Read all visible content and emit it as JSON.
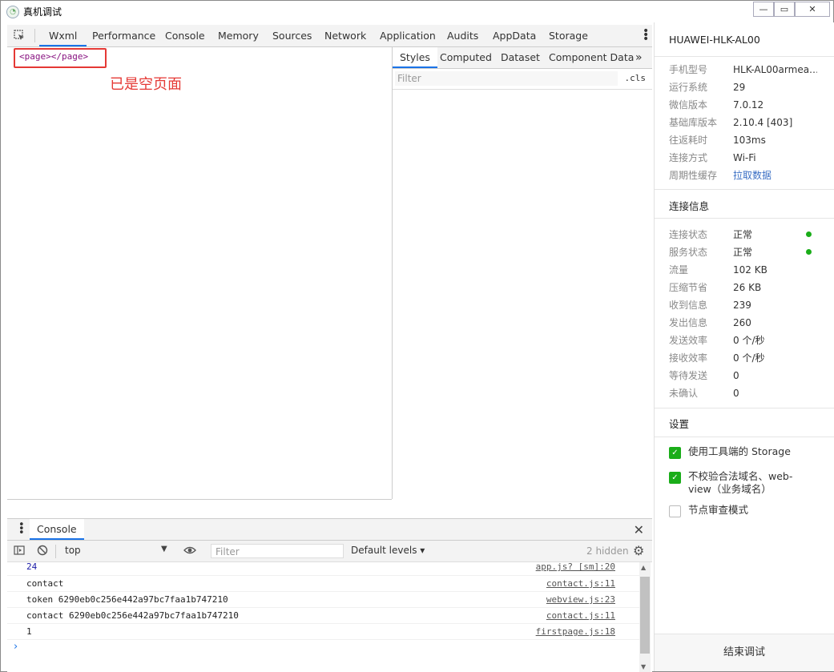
{
  "window": {
    "title": "真机调试",
    "min": "—",
    "restore": "▭",
    "close": "✕"
  },
  "devtools": {
    "tabs": [
      "Wxml",
      "Performance",
      "Console",
      "Memory",
      "Sources",
      "Network",
      "Application",
      "Audits",
      "AppData",
      "Storage"
    ],
    "active_tab": "Wxml"
  },
  "elements": {
    "node": "<page></page>",
    "annotation": "已是空页面"
  },
  "styles": {
    "tabs": [
      "Styles",
      "Computed",
      "Dataset",
      "Component Data"
    ],
    "more": "»",
    "filter_placeholder": "Filter",
    "cls": ".cls"
  },
  "console": {
    "tab": "Console",
    "context": "top",
    "filter_placeholder": "Filter",
    "levels": "Default levels ▾",
    "hidden": "2 hidden",
    "logs": [
      {
        "msg": "24",
        "src": "app.js? [sm]:20",
        "num": true
      },
      {
        "msg": "contact",
        "src": "contact.js:11",
        "num": false
      },
      {
        "msg": "token 6290eb0c256e442a97bc7faa1b747210",
        "src": "webview.js:23",
        "num": false
      },
      {
        "msg": "contact 6290eb0c256e442a97bc7faa1b747210",
        "src": "contact.js:11",
        "num": false
      },
      {
        "msg": "1",
        "src": "firstpage.js:18",
        "num": false
      }
    ],
    "prompt": "›"
  },
  "side": {
    "device": "HUAWEI-HLK-AL00",
    "device_info": [
      {
        "k": "手机型号",
        "v": "HLK-AL00armea…"
      },
      {
        "k": "运行系统",
        "v": "29"
      },
      {
        "k": "微信版本",
        "v": "7.0.12"
      },
      {
        "k": "基础库版本",
        "v": "2.10.4 [403]"
      },
      {
        "k": "往返耗时",
        "v": "103ms"
      },
      {
        "k": "连接方式",
        "v": "Wi-Fi"
      },
      {
        "k": "周期性缓存",
        "v": "拉取数据"
      }
    ],
    "conn_title": "连接信息",
    "conn_info": [
      {
        "k": "连接状态",
        "v": "正常"
      },
      {
        "k": "服务状态",
        "v": "正常"
      },
      {
        "k": "流量",
        "v": "102 KB"
      },
      {
        "k": "压缩节省",
        "v": "26 KB"
      },
      {
        "k": "收到信息",
        "v": "239"
      },
      {
        "k": "发出信息",
        "v": "260"
      },
      {
        "k": "发送效率",
        "v": "0 个/秒"
      },
      {
        "k": "接收效率",
        "v": "0 个/秒"
      },
      {
        "k": "等待发送",
        "v": "0"
      },
      {
        "k": "未确认",
        "v": "0"
      }
    ],
    "settings_title": "设置",
    "settings": [
      {
        "label": "使用工具端的 Storage",
        "checked": true
      },
      {
        "label": "不校验合法域名、web-view（业务域名）",
        "checked": true
      },
      {
        "label": "节点审查模式",
        "checked": false
      }
    ],
    "end_button": "结束调试"
  },
  "colors": {
    "accent": "#1a73e8",
    "annotation_red": "#e53935",
    "status_green": "#1aad19"
  }
}
